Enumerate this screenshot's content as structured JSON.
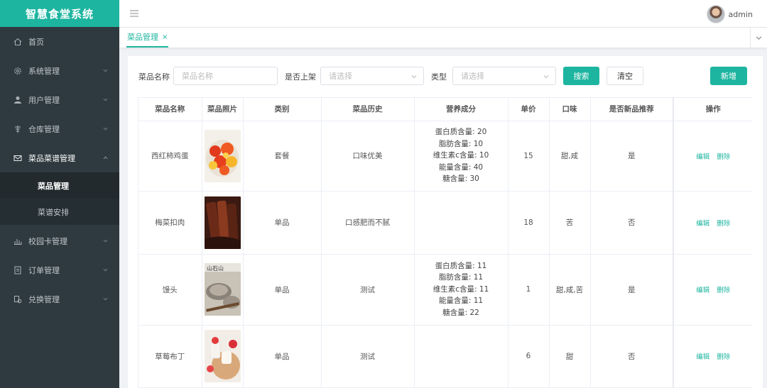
{
  "app": {
    "title": "智慧食堂系统"
  },
  "sidebar": {
    "items": [
      {
        "label": "首页",
        "icon": "home-icon"
      },
      {
        "label": "系统管理",
        "icon": "gear-icon"
      },
      {
        "label": "用户管理",
        "icon": "user-icon"
      },
      {
        "label": "仓库管理",
        "icon": "warehouse-icon"
      },
      {
        "label": "菜品菜谱管理",
        "icon": "mail-icon",
        "children": [
          "菜品管理",
          "菜谱安排"
        ]
      },
      {
        "label": "校园卡管理",
        "icon": "bar-chart-icon"
      },
      {
        "label": "订单管理",
        "icon": "document-icon"
      },
      {
        "label": "兑换管理",
        "icon": "exchange-icon"
      }
    ]
  },
  "header": {
    "username": "admin"
  },
  "tabs": [
    {
      "label": "菜品管理",
      "close": "×"
    }
  ],
  "search": {
    "name_label": "菜品名称",
    "name_placeholder": "菜品名称",
    "onsale_label": "是否上架",
    "onsale_placeholder": "请选择",
    "type_label": "类型",
    "type_placeholder": "请选择",
    "search_btn": "搜索",
    "clear_btn": "清空",
    "add_btn": "新增"
  },
  "table": {
    "columns": [
      "菜品名称",
      "菜品照片",
      "类别",
      "菜品历史",
      "营养成分",
      "单价",
      "口味",
      "是否新品推荐",
      "操作"
    ],
    "edit_label": "编辑",
    "delete_label": "删除",
    "rows": [
      {
        "name": "西红柿鸡蛋",
        "category": "套餐",
        "history": "口味优美",
        "nutrition": [
          "蛋白质含量: 20",
          "脂肪含量: 10",
          "维生素c含量: 10",
          "能量含量: 40",
          "糖含量: 30"
        ],
        "price": "15",
        "taste": "甜,咸",
        "recommend": "是"
      },
      {
        "name": "梅菜扣肉",
        "category": "单品",
        "history": "口感肥而不腻",
        "nutrition": [],
        "price": "18",
        "taste": "苦",
        "recommend": "否"
      },
      {
        "name": "馒头",
        "category": "单品",
        "history": "测试",
        "nutrition": [
          "蛋白质含量: 11",
          "脂肪含量: 11",
          "维生素c含量: 11",
          "能量含量: 11",
          "糖含量: 22"
        ],
        "price": "1",
        "taste": "甜,咸,苦",
        "recommend": "是"
      },
      {
        "name": "草莓布丁",
        "category": "单品",
        "history": "测试",
        "nutrition": [],
        "price": "6",
        "taste": "甜",
        "recommend": "否"
      }
    ]
  },
  "colors": {
    "accent": "#1eb5a0",
    "sidebar_bg": "#2f3a40"
  }
}
